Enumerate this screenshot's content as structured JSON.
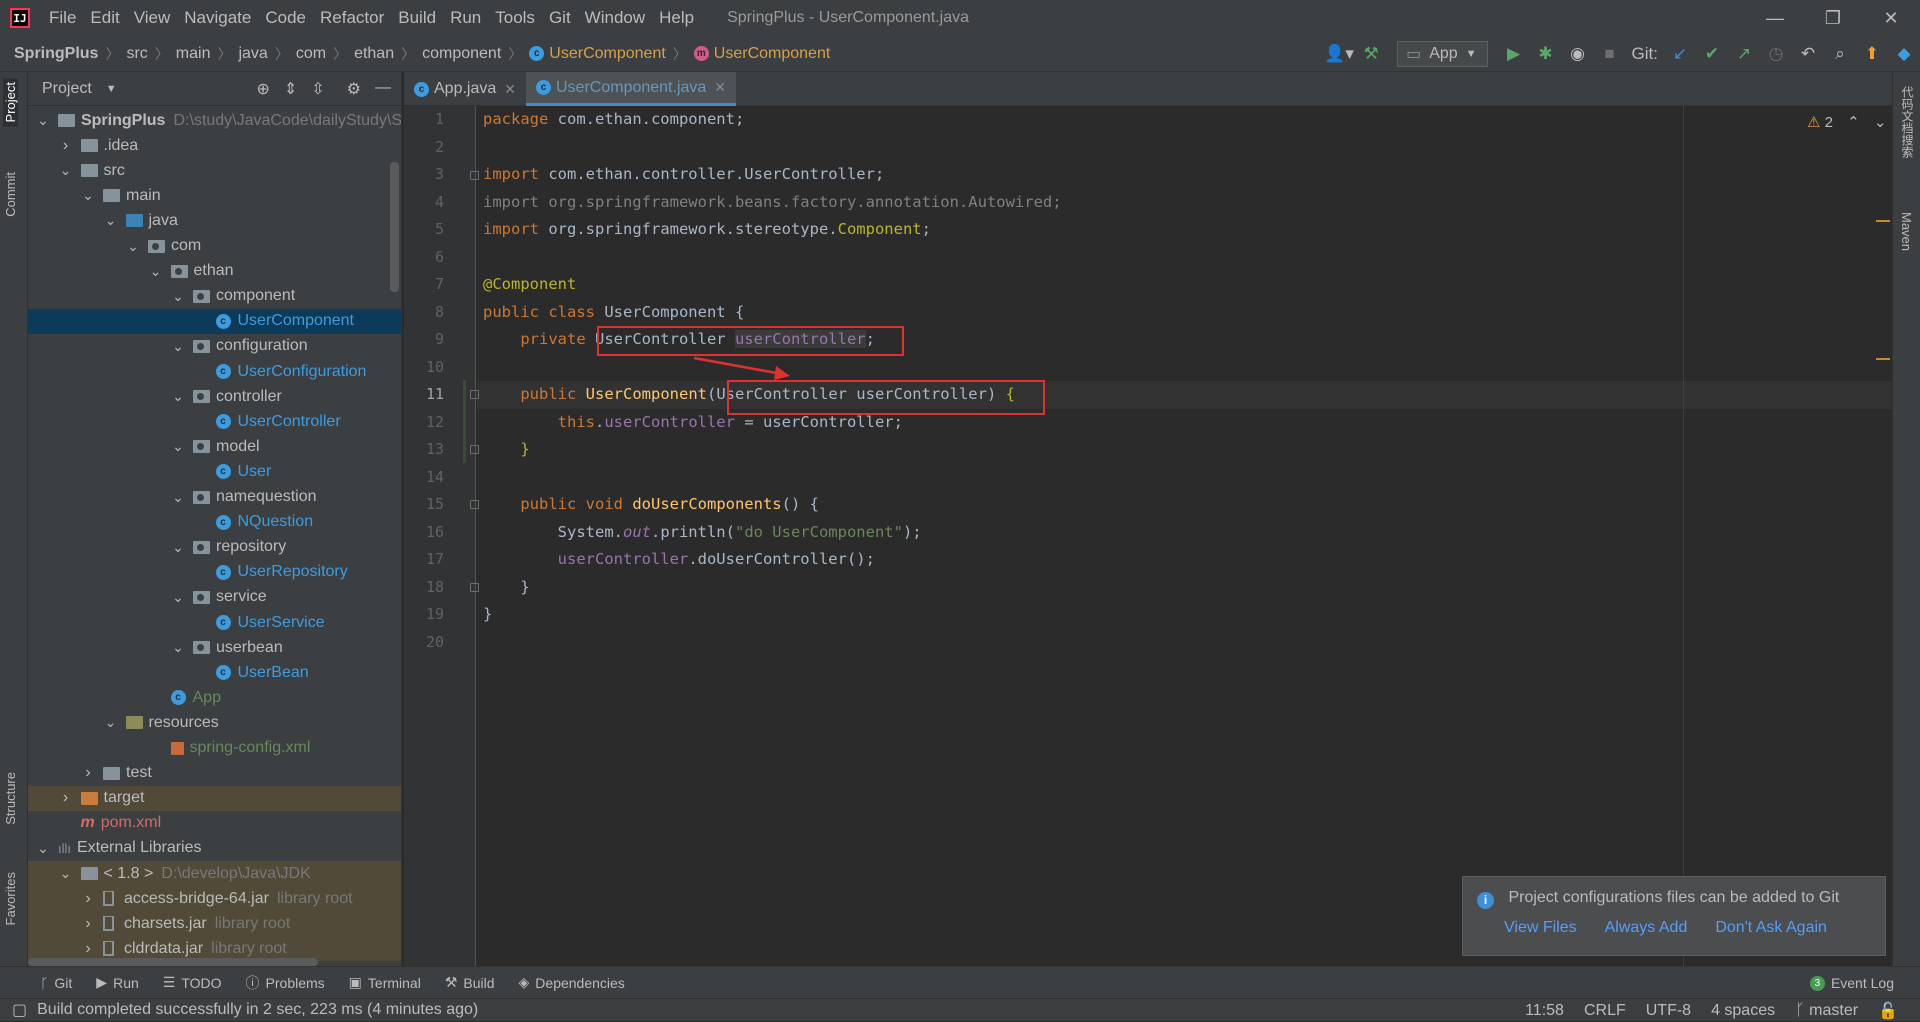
{
  "app": {
    "window_title": "SpringPlus - UserComponent.java",
    "menu": [
      "File",
      "Edit",
      "View",
      "Navigate",
      "Code",
      "Refactor",
      "Build",
      "Run",
      "Tools",
      "Git",
      "Window",
      "Help"
    ]
  },
  "breadcrumb": {
    "items": [
      "SpringPlus",
      "src",
      "main",
      "java",
      "com",
      "ethan",
      "component",
      "UserComponent",
      "UserComponent"
    ]
  },
  "toolbar": {
    "run_config": "App",
    "git_label": "Git:"
  },
  "left_tabs": [
    "Project",
    "Commit",
    "Structure",
    "Favorites"
  ],
  "right_tabs": [
    "代码文档搜索",
    "Maven"
  ],
  "project_panel": {
    "title": "Project",
    "tree": [
      {
        "label": "SpringPlus",
        "suffix": "D:\\study\\JavaCode\\dailyStudy\\S",
        "depth": 0,
        "kind": "module",
        "open": true,
        "bold": true
      },
      {
        "label": ".idea",
        "depth": 1,
        "kind": "folder",
        "open": false
      },
      {
        "label": "src",
        "depth": 1,
        "kind": "folder",
        "open": true
      },
      {
        "label": "main",
        "depth": 2,
        "kind": "folder",
        "open": true
      },
      {
        "label": "java",
        "depth": 3,
        "kind": "blue",
        "open": true
      },
      {
        "label": "com",
        "depth": 4,
        "kind": "pkg",
        "open": true
      },
      {
        "label": "ethan",
        "depth": 5,
        "kind": "pkg",
        "open": true
      },
      {
        "label": "component",
        "depth": 6,
        "kind": "pkg",
        "open": true
      },
      {
        "label": "UserComponent",
        "depth": 7,
        "kind": "class",
        "selected": true
      },
      {
        "label": "configuration",
        "depth": 6,
        "kind": "pkg",
        "open": true
      },
      {
        "label": "UserConfiguration",
        "depth": 7,
        "kind": "class"
      },
      {
        "label": "controller",
        "depth": 6,
        "kind": "pkg",
        "open": true
      },
      {
        "label": "UserController",
        "depth": 7,
        "kind": "class"
      },
      {
        "label": "model",
        "depth": 6,
        "kind": "pkg",
        "open": true
      },
      {
        "label": "User",
        "depth": 7,
        "kind": "class"
      },
      {
        "label": "namequestion",
        "depth": 6,
        "kind": "pkg",
        "open": true
      },
      {
        "label": "NQuestion",
        "depth": 7,
        "kind": "class"
      },
      {
        "label": "repository",
        "depth": 6,
        "kind": "pkg",
        "open": true
      },
      {
        "label": "UserRepository",
        "depth": 7,
        "kind": "class"
      },
      {
        "label": "service",
        "depth": 6,
        "kind": "pkg",
        "open": true
      },
      {
        "label": "UserService",
        "depth": 7,
        "kind": "class"
      },
      {
        "label": "userbean",
        "depth": 6,
        "kind": "pkg",
        "open": true
      },
      {
        "label": "UserBean",
        "depth": 7,
        "kind": "class"
      },
      {
        "label": "App",
        "depth": 5,
        "kind": "appclass"
      },
      {
        "label": "resources",
        "depth": 3,
        "kind": "res",
        "open": true
      },
      {
        "label": "spring-config.xml",
        "depth": 5,
        "kind": "xml"
      },
      {
        "label": "test",
        "depth": 2,
        "kind": "folder",
        "open": false
      },
      {
        "label": "target",
        "depth": 1,
        "kind": "orange",
        "open": false,
        "highlight": true
      },
      {
        "label": "pom.xml",
        "depth": 1,
        "kind": "maven"
      },
      {
        "label": "External Libraries",
        "depth": 0,
        "kind": "lib",
        "open": true
      },
      {
        "label": "< 1.8 >",
        "suffix": "D:\\develop\\Java\\JDK",
        "depth": 1,
        "kind": "jdk",
        "open": true,
        "highlight": true
      },
      {
        "label": "access-bridge-64.jar",
        "suffix": "library root",
        "depth": 2,
        "kind": "jar",
        "open": false,
        "highlight": true
      },
      {
        "label": "charsets.jar",
        "suffix": "library root",
        "depth": 2,
        "kind": "jar",
        "open": false,
        "highlight": true
      },
      {
        "label": "cldrdata.jar",
        "suffix": "library root",
        "depth": 2,
        "kind": "jar",
        "open": false,
        "highlight": true
      }
    ]
  },
  "editor": {
    "tabs": [
      {
        "label": "App.java",
        "active": false
      },
      {
        "label": "UserComponent.java",
        "active": true
      }
    ],
    "warning_count": "2",
    "current_line": 11
  },
  "notification": {
    "message": "Project configurations files can be added to Git",
    "actions": [
      "View Files",
      "Always Add",
      "Don't Ask Again"
    ]
  },
  "bottom_tools": [
    "Git",
    "Run",
    "TODO",
    "Problems",
    "Terminal",
    "Build",
    "Dependencies"
  ],
  "event_log": {
    "label": "Event Log",
    "count": "3"
  },
  "status": {
    "message": "Build completed successfully in 2 sec, 223 ms (4 minutes ago)",
    "position": "11:58",
    "line_sep": "CRLF",
    "encoding": "UTF-8",
    "indent": "4 spaces",
    "branch": "master"
  }
}
